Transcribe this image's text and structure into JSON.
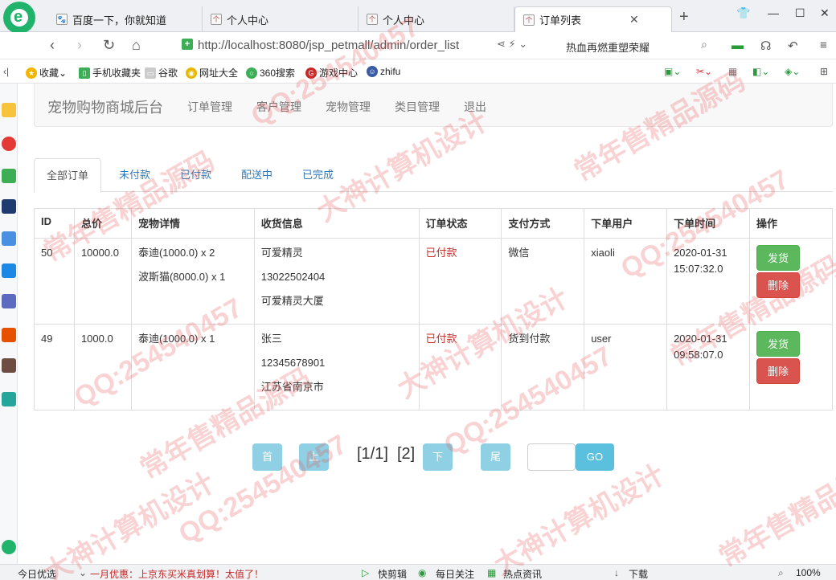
{
  "browser": {
    "tabs": [
      {
        "label": "百度一下，你就知道"
      },
      {
        "label": "个人中心"
      },
      {
        "label": "个人中心"
      },
      {
        "label": "订单列表"
      }
    ],
    "url": "http://localhost:8080/jsp_petmall/admin/order_list",
    "search_text": "热血再燃重塑荣耀",
    "bookmarks": [
      "收藏",
      "手机收藏夹",
      "谷歌",
      "网址大全",
      "360搜索",
      "游戏中心",
      "zhifu"
    ]
  },
  "statusbar": {
    "left": "今日优选",
    "promo": "一月优惠：上京东买米真划算！太值了！",
    "items": [
      "快剪辑",
      "每日关注",
      "热点资讯",
      "下载"
    ],
    "zoom": "100%"
  },
  "nav": {
    "brand": "宠物购物商城后台",
    "links": [
      "订单管理",
      "客户管理",
      "宠物管理",
      "类目管理",
      "退出"
    ]
  },
  "subtabs": [
    "全部订单",
    "未付款",
    "已付款",
    "配送中",
    "已完成"
  ],
  "table": {
    "headers": [
      "ID",
      "总价",
      "宠物详情",
      "收货信息",
      "订单状态",
      "支付方式",
      "下单用户",
      "下单时间",
      "操作"
    ],
    "rows": [
      {
        "id": "50",
        "total": "10000.0",
        "items": [
          "泰迪(1000.0) x 2",
          "波斯猫(8000.0) x 1"
        ],
        "receiver": [
          "可爱精灵",
          "13022502404",
          "可爱精灵大厦"
        ],
        "status": "已付款",
        "payment": "微信",
        "user": "xiaoli",
        "date": "2020-01-31",
        "time": "15:07:32.0",
        "ship": "发货",
        "delete": "删除"
      },
      {
        "id": "49",
        "total": "1000.0",
        "items": [
          "泰迪(1000.0) x 1"
        ],
        "receiver": [
          "张三",
          "12345678901",
          "江苏省南京市"
        ],
        "status": "已付款",
        "payment": "货到付款",
        "user": "user",
        "date": "2020-01-31",
        "time": "09:58:07.0",
        "ship": "发货",
        "delete": "删除"
      }
    ]
  },
  "pager": {
    "first": "首页",
    "prev": "上一页",
    "info": "[1/1]",
    "info2": "[2]",
    "next": "下一页",
    "last": "尾页",
    "go": "GO"
  },
  "watermarks": [
    "常年售精品源码",
    "QQ:254540457",
    "大神计算机设计"
  ]
}
